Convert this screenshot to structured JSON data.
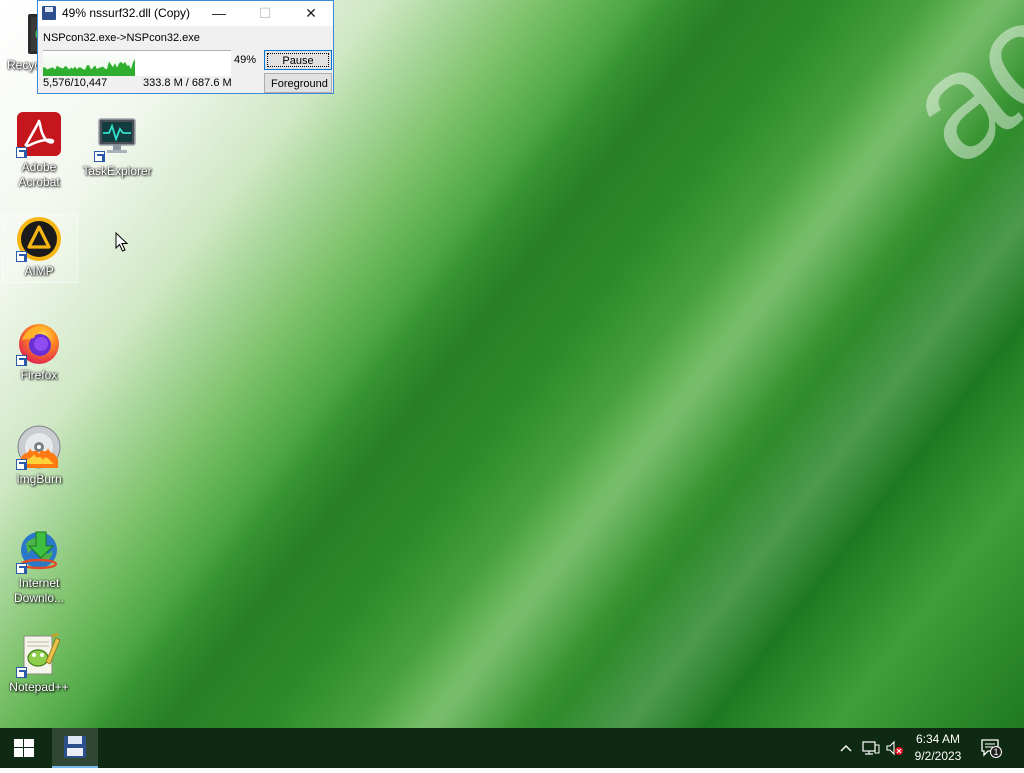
{
  "desktop": {
    "wallpaper_logo": "ace",
    "icons": [
      {
        "label": "Recycle",
        "icon": "recycle-bin-icon"
      },
      {
        "label": "Adobe Acrobat",
        "icon": "adobe-acrobat-icon"
      },
      {
        "label": "TaskExplorer",
        "icon": "task-explorer-icon"
      },
      {
        "label": "AIMP",
        "icon": "aimp-icon"
      },
      {
        "label": "Firefox",
        "icon": "firefox-icon"
      },
      {
        "label": "ImgBurn",
        "icon": "imgburn-icon"
      },
      {
        "label": "Internet Downlo...",
        "icon": "internet-download-manager-icon"
      },
      {
        "label": "Notepad++",
        "icon": "notepadpp-icon"
      }
    ]
  },
  "copy_dialog": {
    "title": "49% nssurf32.dll (Copy)",
    "transfer": "NSPcon32.exe->NSPcon32.exe",
    "percent": "49%",
    "progress_fraction": 0.49,
    "file_count": "5,576/10,447",
    "size": "333.8 M / 687.6 M",
    "pause_label": "Pause",
    "foreground_label": "Foreground",
    "minimize_glyph": "—",
    "maximize_glyph": "☐",
    "close_glyph": "✕"
  },
  "taskbar": {
    "time": "6:34 AM",
    "date": "9/2/2023",
    "notification_count": "1"
  },
  "colors": {
    "taskbar_bg": "#0f2a12",
    "accent": "#0078d7",
    "graph_green": "#2fae2f"
  }
}
